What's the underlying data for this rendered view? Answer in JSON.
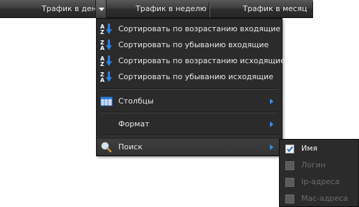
{
  "header": {
    "columns": [
      {
        "label": "Трафик в день"
      },
      {
        "label": "Трафик в неделю"
      },
      {
        "label": "Трафик в месяц"
      }
    ]
  },
  "menu": {
    "items": [
      {
        "label": "Сортировать по возрастанию входящие",
        "icon": "sort-az-icon"
      },
      {
        "label": "Сортировать по убыванию входящие",
        "icon": "sort-za-icon"
      },
      {
        "label": "Сортировать по возрастанию исходящие",
        "icon": "sort-az-icon"
      },
      {
        "label": "Сортировать по убыванию исходящие",
        "icon": "sort-za-icon"
      },
      {
        "label": "Столбцы",
        "icon": "columns-icon",
        "submenu": true
      },
      {
        "label": "Формат",
        "submenu": true
      },
      {
        "label": "Поиск",
        "icon": "search-icon",
        "submenu": true,
        "active": true
      }
    ]
  },
  "submenu": {
    "items": [
      {
        "label": "Имя",
        "checked": true,
        "enabled": true
      },
      {
        "label": "Логин",
        "checked": false,
        "enabled": false
      },
      {
        "label": "Ip-адреса",
        "checked": false,
        "enabled": false
      },
      {
        "label": "Mac-адреса",
        "checked": false,
        "enabled": false
      }
    ]
  },
  "colors": {
    "menu_bg": "#2b2b2b",
    "accent_arrow": "#3f8fe8",
    "disabled_text": "#6d6d6d"
  }
}
